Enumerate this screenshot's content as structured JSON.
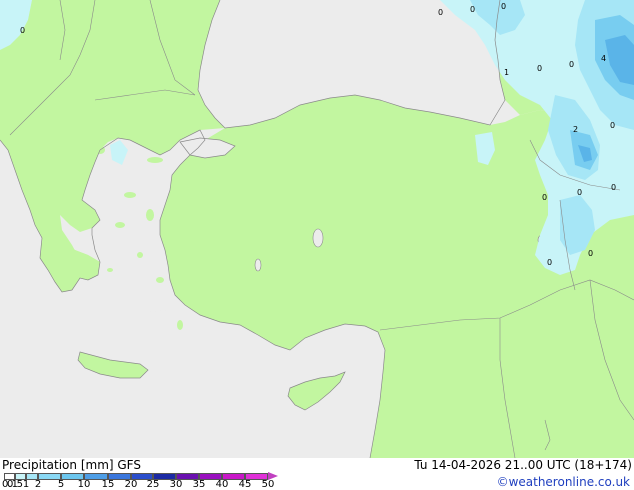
{
  "map": {
    "colors": {
      "sea": "#ececec",
      "land": "#c2f6a0",
      "coast": "#8a8a8a",
      "precip_light": "#c8f4f8",
      "precip_medium": "#a6e6f6",
      "precip_heavy": "#78cdf0",
      "precip_max": "#5ab4e8"
    },
    "cell_values": [
      {
        "id": "v1",
        "text": "0"
      },
      {
        "id": "v2",
        "text": "0"
      },
      {
        "id": "v3",
        "text": "0"
      },
      {
        "id": "v4",
        "text": "0"
      },
      {
        "id": "v5",
        "text": "1"
      },
      {
        "id": "v6",
        "text": "0"
      },
      {
        "id": "v7",
        "text": "0"
      },
      {
        "id": "v8",
        "text": "4"
      },
      {
        "id": "v9",
        "text": "2"
      },
      {
        "id": "v10",
        "text": "0"
      },
      {
        "id": "v11",
        "text": "0"
      },
      {
        "id": "v12",
        "text": "0"
      },
      {
        "id": "v13",
        "text": "0"
      },
      {
        "id": "v14",
        "text": "0"
      },
      {
        "id": "v15",
        "text": "0"
      }
    ]
  },
  "footer": {
    "title": "Precipitation [mm]  GFS",
    "datetime": "Tu 14-04-2026 21..00 UTC (18+174)",
    "credit": "©weatheronline.co.uk",
    "legend": {
      "ticks": [
        "0.1",
        "0.5",
        "1",
        "2",
        "5",
        "10",
        "15",
        "20",
        "25",
        "30",
        "35",
        "40",
        "45",
        "50"
      ],
      "colors": [
        "#ffffff",
        "#c8f4f8",
        "#a6e6f6",
        "#8ad8f4",
        "#6cc6ee",
        "#4e9ee6",
        "#3a76dc",
        "#2a4ecc",
        "#1c2aa4",
        "#6a10b0",
        "#9a10c0",
        "#c818c8",
        "#e030d8",
        "#f060e8"
      ]
    }
  }
}
